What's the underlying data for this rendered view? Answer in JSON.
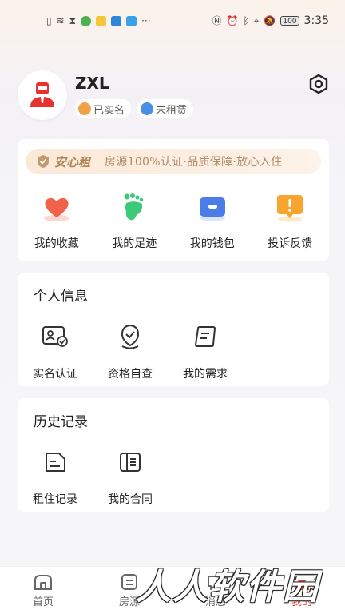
{
  "status_bar": {
    "time": "3:35",
    "battery": "100"
  },
  "profile": {
    "username": "ZXL",
    "badge_verified": "已实名",
    "badge_renting": "未租赁"
  },
  "banner": {
    "title": "安心租",
    "subtitle": "房源100%认证·品质保障·放心入住"
  },
  "quick_actions": [
    {
      "label": "我的收藏",
      "icon": "heart-icon"
    },
    {
      "label": "我的足迹",
      "icon": "footprint-icon"
    },
    {
      "label": "我的钱包",
      "icon": "wallet-icon"
    },
    {
      "label": "投诉反馈",
      "icon": "complaint-icon"
    }
  ],
  "personal_info": {
    "title": "个人信息",
    "items": [
      {
        "label": "实名认证",
        "icon": "id-card-icon"
      },
      {
        "label": "资格自查",
        "icon": "qualification-check-icon"
      },
      {
        "label": "我的需求",
        "icon": "document-icon"
      }
    ]
  },
  "history": {
    "title": "历史记录",
    "items": [
      {
        "label": "租住记录",
        "icon": "rental-record-icon"
      },
      {
        "label": "我的合同",
        "icon": "contract-icon"
      }
    ]
  },
  "tabbar": {
    "items": [
      {
        "label": "首页",
        "icon": "home-icon"
      },
      {
        "label": "房源",
        "icon": "listings-icon"
      },
      {
        "label": "消息",
        "icon": "message-icon"
      },
      {
        "label": "我的",
        "icon": "mine-icon"
      }
    ]
  },
  "watermark": "人人软件园",
  "colors": {
    "accent": "#e84a3a",
    "banner_text": "#b08456",
    "heart": "#f0634a",
    "footprint": "#3dc97a",
    "wallet": "#4a7de8",
    "complaint": "#f7a52e"
  }
}
